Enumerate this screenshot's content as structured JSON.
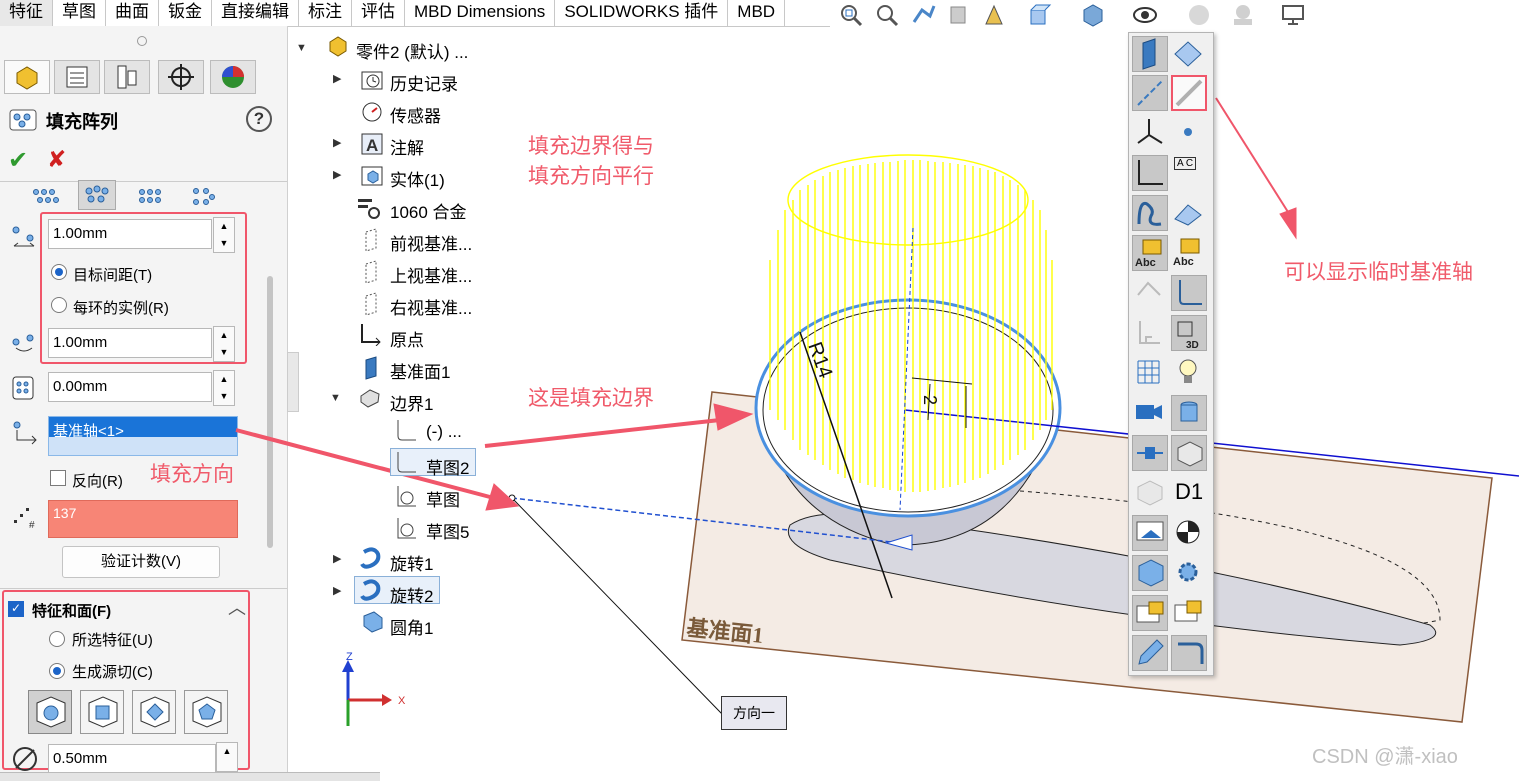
{
  "tabs": [
    "特征",
    "草图",
    "曲面",
    "钣金",
    "直接编辑",
    "标注",
    "评估",
    "MBD Dimensions",
    "SOLIDWORKS 插件",
    "MBD"
  ],
  "property_manager": {
    "title": "填充阵列",
    "help": "?",
    "spacing_value": "1.00mm",
    "radio_target_spacing": "目标间距(T)",
    "radio_instances_per_loop": "每环的实例(R)",
    "loop_spacing_value": "1.00mm",
    "offset_value": "0.00mm",
    "direction_selection": "基准轴<1>",
    "reverse_label": "反向(R)",
    "instance_count": "137",
    "verify_button": "验证计数(V)",
    "features_section_title": "特征和面(F)",
    "radio_selected_features": "所选特征(U)",
    "radio_generate_seed_cut": "生成源切(C)",
    "bottom_value": "0.50mm"
  },
  "tree": {
    "root": "零件2 (默认) ...",
    "items": [
      "历史记录",
      "传感器",
      "注解",
      "实体(1)",
      "1060 合金",
      "前视基准...",
      "上视基准...",
      "右视基准...",
      "原点",
      "基准面1",
      "边界1",
      "(-) ...",
      "草图2",
      "草图",
      "草图5",
      "旋转1",
      "旋转2",
      "圆角1"
    ]
  },
  "annotations": {
    "boundary_parallel_line1": "填充边界得与",
    "boundary_parallel_line2": "填充方向平行",
    "fill_boundary": "这是填充边界",
    "fill_direction": "填充方向",
    "temp_axis": "可以显示临时基准轴"
  },
  "viewport": {
    "radius_label": "R14",
    "dim_label": "2",
    "plane_label": "基准面1",
    "direction_callout": "方向一",
    "triad_x": "X",
    "triad_z": "Z"
  },
  "vtoolbar": {
    "d1_label": "D1",
    "abc": "Abc",
    "ac": "A C",
    "3d": "3D"
  },
  "watermark": "CSDN @潇-xiao",
  "colors": {
    "annotation": "#f0566a",
    "selection_blue": "#1c64c8",
    "hatch_yellow": "#ffff00",
    "axis_blue": "#1010d0"
  }
}
